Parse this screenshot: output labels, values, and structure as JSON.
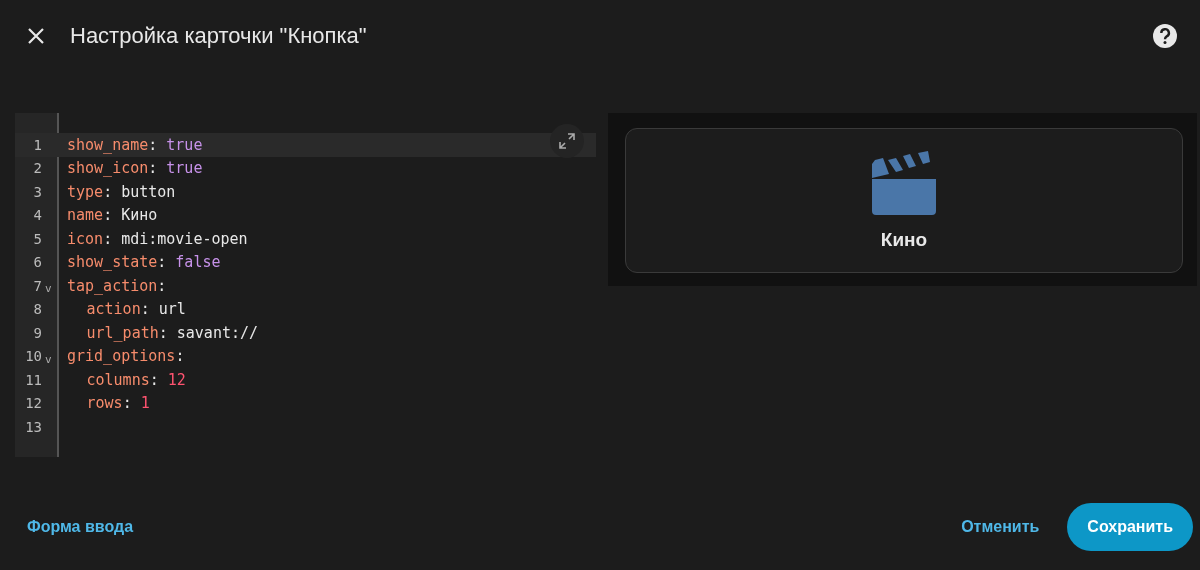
{
  "dialog": {
    "title": "Настройка карточки \"Кнопка\""
  },
  "editor": {
    "lines": [
      {
        "number": "1",
        "key": "show_name",
        "colon": ":",
        "value": "true",
        "kind": "bool",
        "active": true
      },
      {
        "number": "2",
        "key": "show_icon",
        "colon": ":",
        "value": "true",
        "kind": "bool",
        "active": false
      },
      {
        "number": "3",
        "key": "type",
        "colon": ":",
        "value": "button",
        "kind": "string",
        "active": false
      },
      {
        "number": "4",
        "key": "name",
        "colon": ":",
        "value": "Кино",
        "kind": "string",
        "active": false
      },
      {
        "number": "5",
        "key": "icon",
        "colon": ":",
        "value": "mdi:movie-open",
        "kind": "string",
        "active": false
      },
      {
        "number": "6",
        "key": "show_state",
        "colon": ":",
        "value": "false",
        "kind": "bool",
        "active": false
      },
      {
        "number": "7",
        "key": "tap_action",
        "colon": ":",
        "fold": "v",
        "active": false,
        "children": [
          {
            "number": "8",
            "key": "action",
            "colon": ":",
            "value": "url",
            "kind": "string",
            "active": false
          },
          {
            "number": "9",
            "key": "url_path",
            "colon": ":",
            "value": "savant://",
            "kind": "string",
            "active": false
          }
        ]
      },
      {
        "number": "10",
        "key": "grid_options",
        "colon": ":",
        "fold": "v",
        "active": false,
        "children": [
          {
            "number": "11",
            "key": "columns",
            "colon": ":",
            "value": "12",
            "kind": "number",
            "active": false
          },
          {
            "number": "12",
            "key": "rows",
            "colon": ":",
            "value": "1",
            "kind": "number",
            "active": false
          }
        ]
      },
      {
        "number": "13",
        "active": false
      }
    ]
  },
  "preview": {
    "name": "Кино"
  },
  "footer": {
    "mode_link": "Форма ввода",
    "cancel": "Отменить",
    "save": "Сохранить"
  }
}
